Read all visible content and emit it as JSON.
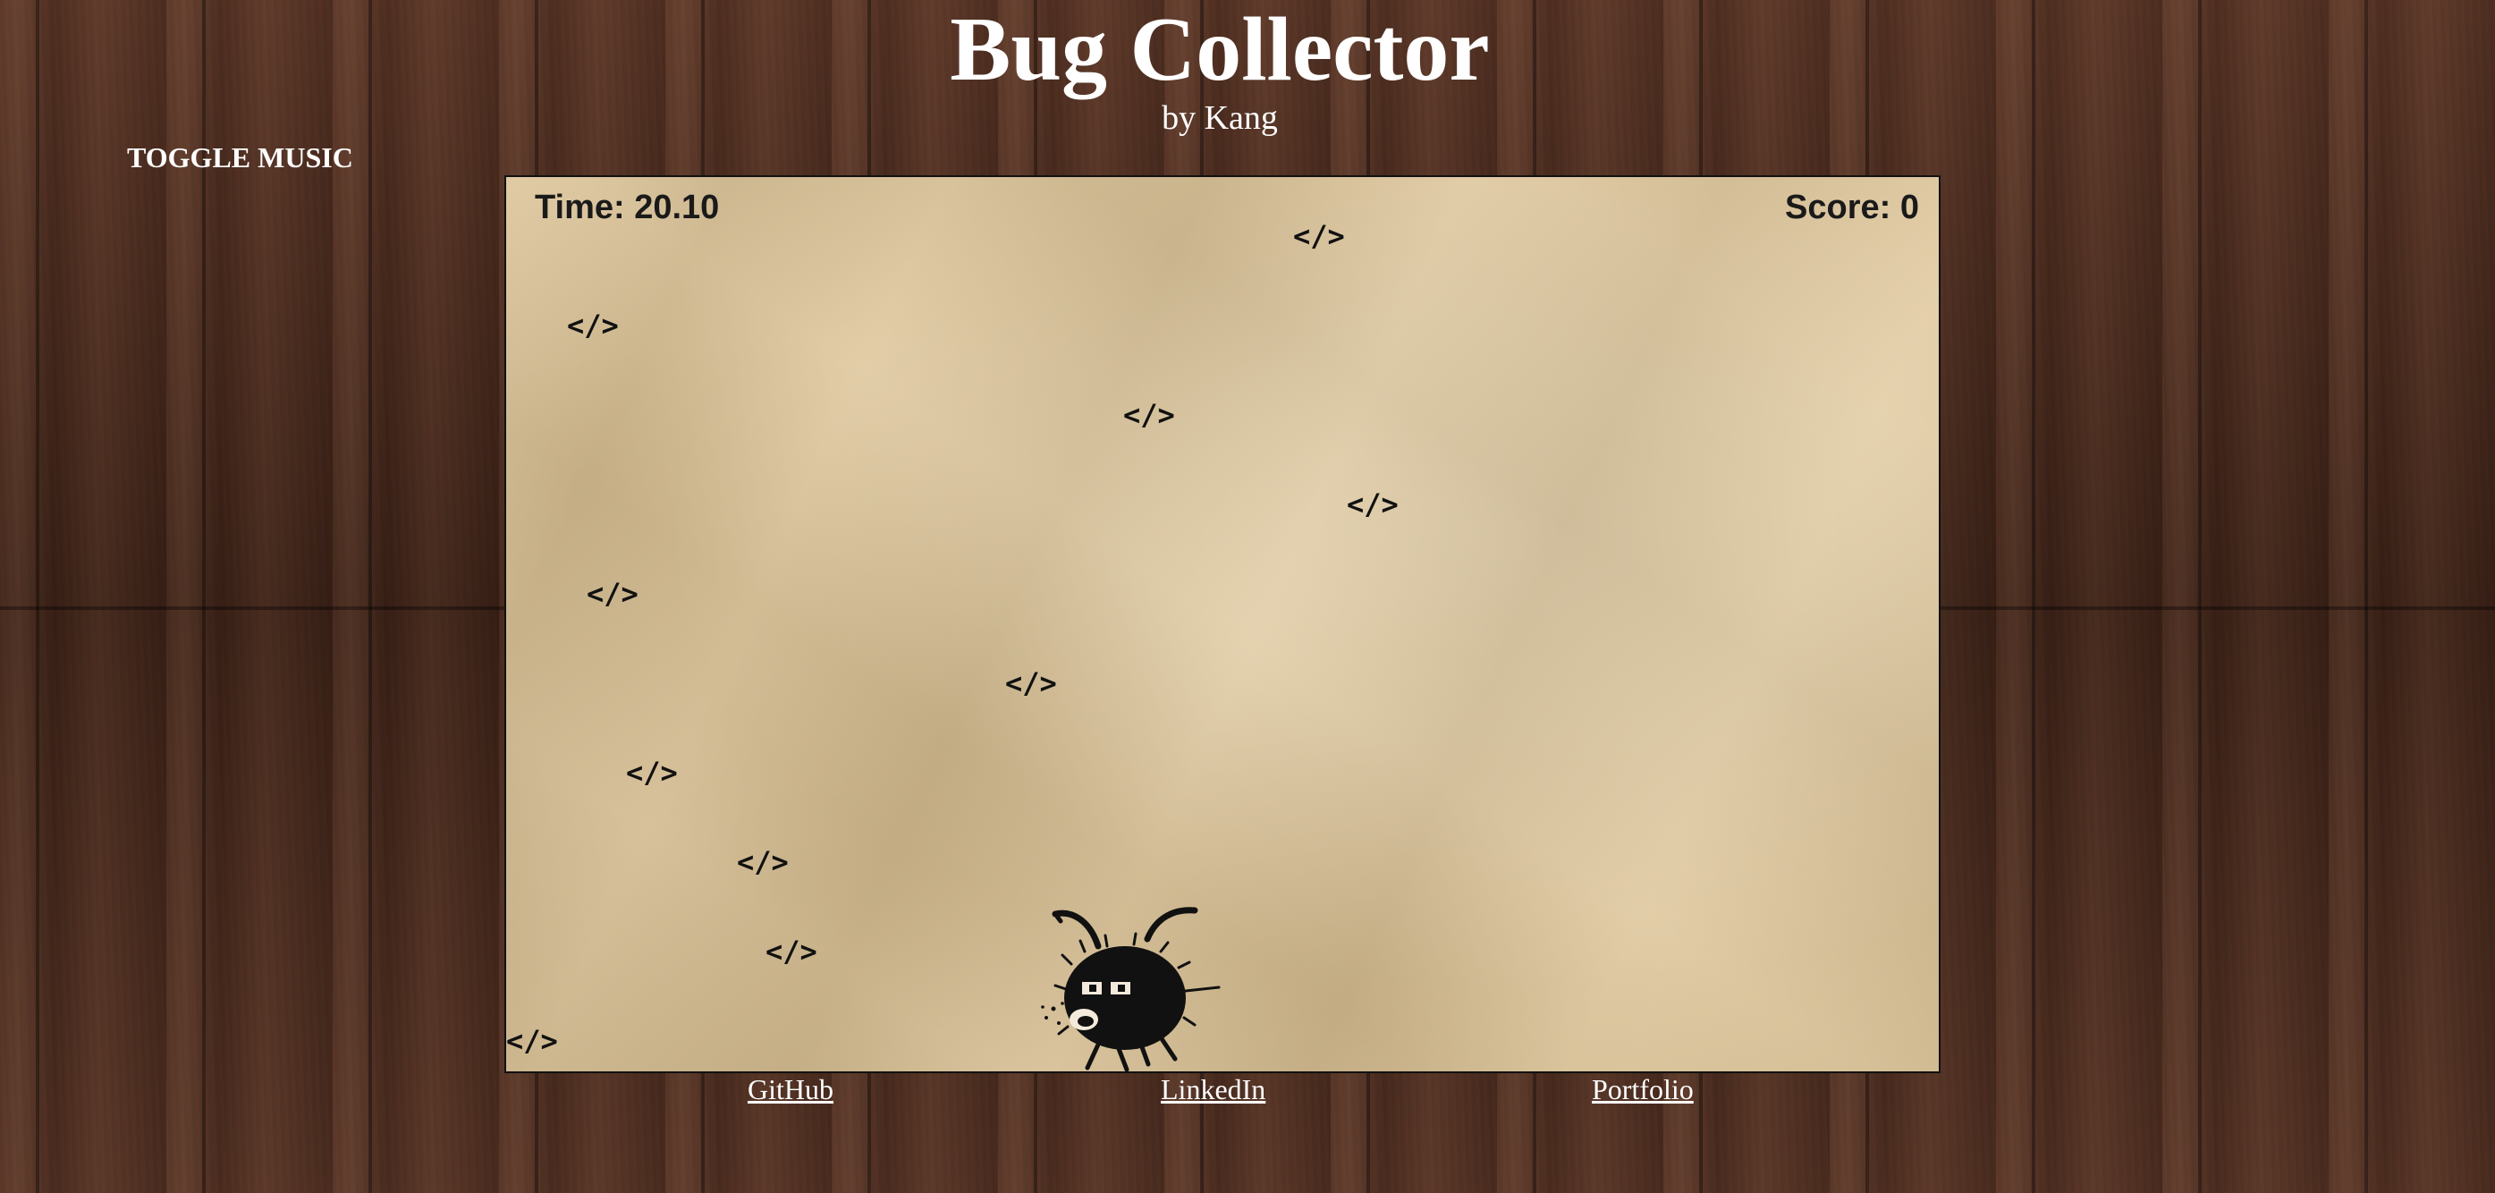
{
  "header": {
    "title": "Bug Collector",
    "subtitle": "by Kang"
  },
  "controls": {
    "toggle_music_label": "TOGGLE MUSIC"
  },
  "hud": {
    "time_text": "Time: 20.10",
    "score_text": "Score: 0"
  },
  "bugs": [
    {
      "label": "</>"
    },
    {
      "label": "</>"
    },
    {
      "label": "</>"
    },
    {
      "label": "</>"
    },
    {
      "label": "</>"
    },
    {
      "label": "</>"
    },
    {
      "label": "</>"
    },
    {
      "label": "</>"
    },
    {
      "label": "</>"
    },
    {
      "label": "</>"
    }
  ],
  "player": {
    "icon": "black-bug-creature-icon"
  },
  "footer": {
    "links": [
      {
        "label": "GitHub"
      },
      {
        "label": "LinkedIn"
      },
      {
        "label": "Portfolio"
      }
    ]
  },
  "colors": {
    "background_wood": "#4a2a1c",
    "paper": "#dcc396",
    "text_light": "#ffffff",
    "text_dark": "#111111"
  }
}
